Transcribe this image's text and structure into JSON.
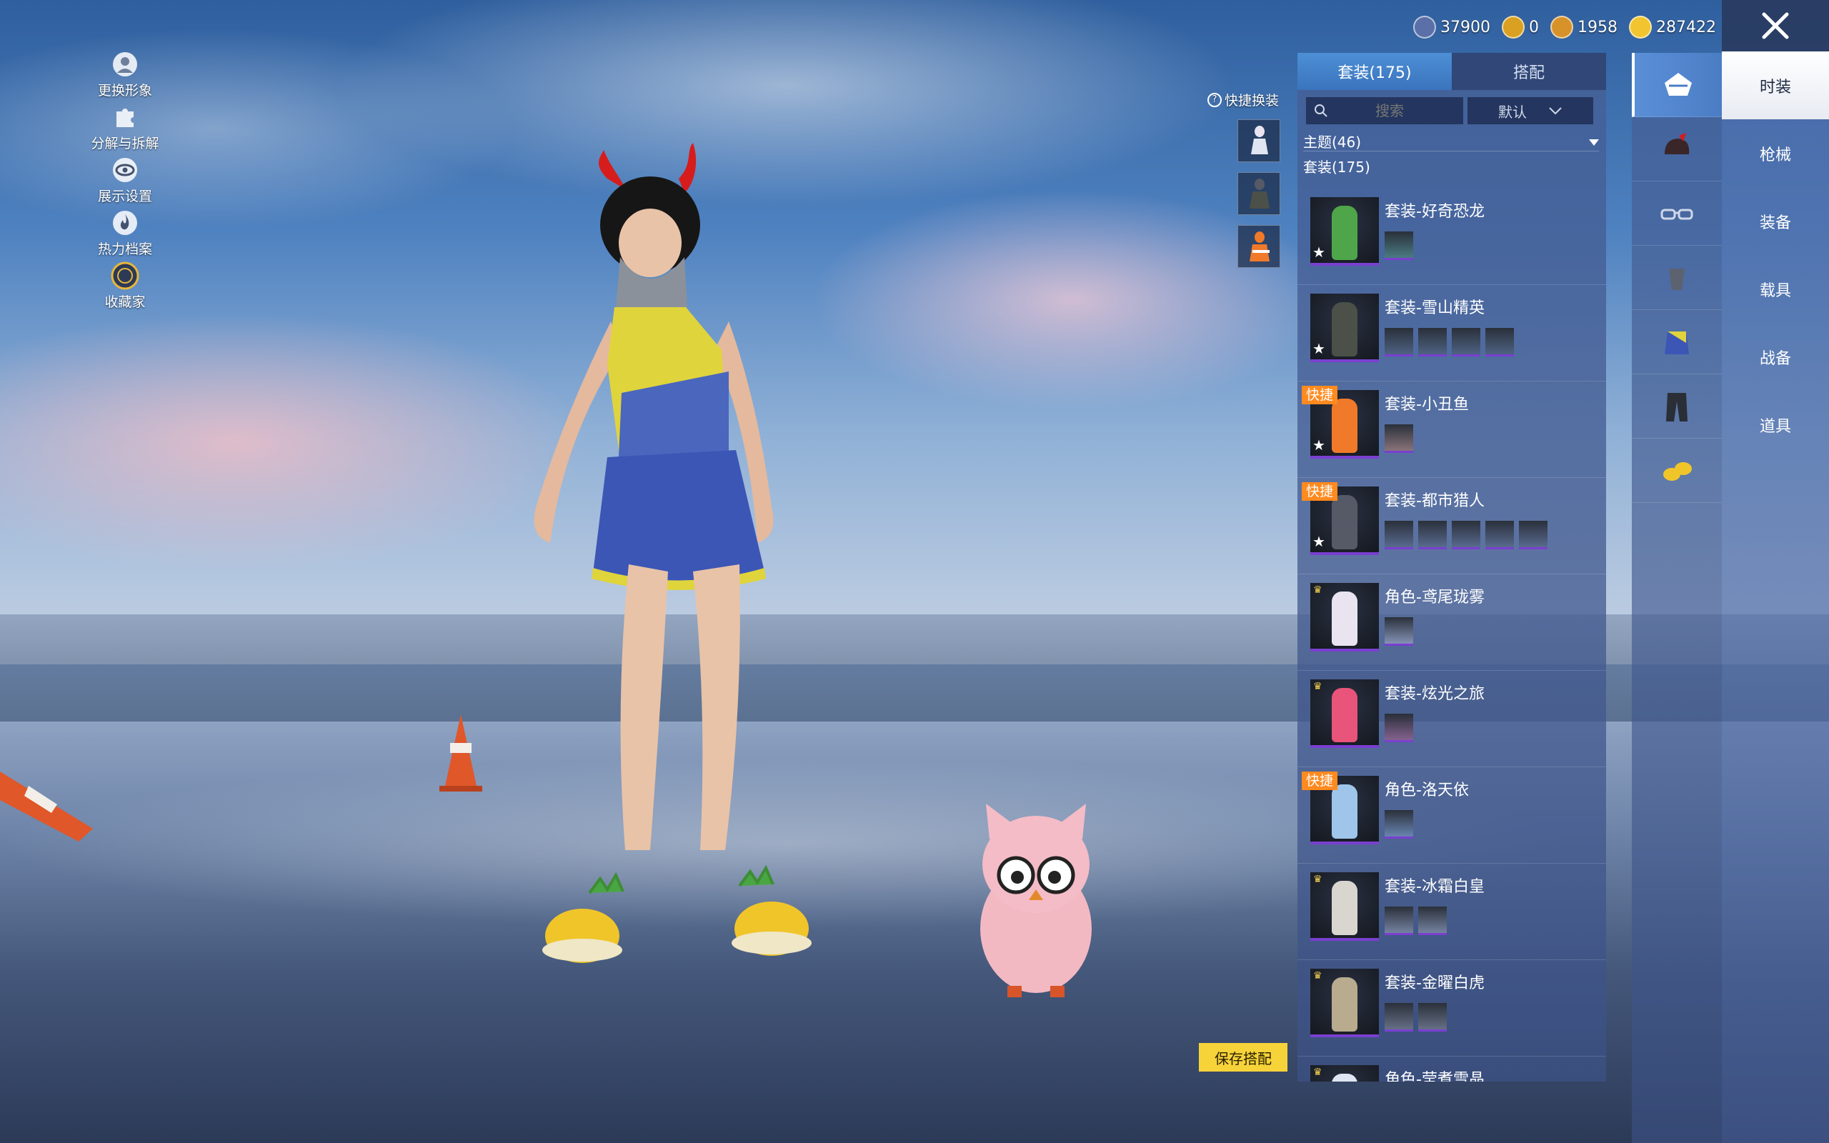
{
  "currencies": [
    {
      "value": "37900",
      "color": "#5b6fa8",
      "icon": "silver-coin-icon"
    },
    {
      "value": "0",
      "color": "#d9a021",
      "icon": "gold-a-coin-icon"
    },
    {
      "value": "1958",
      "color": "#d7922a",
      "icon": "bronze-coin-icon"
    },
    {
      "value": "287422",
      "color": "#f2c430",
      "icon": "lightning-coin-icon"
    }
  ],
  "left_menu": [
    {
      "label": "更换形象",
      "icon": "avatar-icon"
    },
    {
      "label": "分解与拆解",
      "icon": "puzzle-icon"
    },
    {
      "label": "展示设置",
      "icon": "eye-icon"
    },
    {
      "label": "热力档案",
      "icon": "flame-icon"
    },
    {
      "label": "收藏家",
      "icon": "collector-badge-icon"
    }
  ],
  "quick_swap": {
    "title": "快捷换装"
  },
  "panel": {
    "tabs": [
      {
        "label": "套装(175)",
        "active": true
      },
      {
        "label": "搭配",
        "active": false
      }
    ],
    "search_placeholder": "搜索",
    "sort_label": "默认",
    "theme_label": "主题(46)",
    "section_title": "套装(175)",
    "quick_tag": "快捷",
    "items": [
      {
        "name": "套装-好奇恐龙",
        "sub_count": 1,
        "quick": false,
        "star": true,
        "crown": false,
        "color": "#4fa54a"
      },
      {
        "name": "套装-雪山精英",
        "sub_count": 4,
        "quick": false,
        "star": true,
        "crown": false,
        "color": "#4b5048"
      },
      {
        "name": "套装-小丑鱼",
        "sub_count": 1,
        "quick": true,
        "star": true,
        "crown": false,
        "color": "#f07a2a"
      },
      {
        "name": "套装-都市猎人",
        "sub_count": 5,
        "quick": true,
        "star": true,
        "crown": false,
        "color": "#555a66"
      },
      {
        "name": "角色-鸢尾珑雾",
        "sub_count": 1,
        "quick": false,
        "star": false,
        "crown": true,
        "color": "#e9e4f0"
      },
      {
        "name": "套装-炫光之旅",
        "sub_count": 1,
        "quick": false,
        "star": false,
        "crown": true,
        "color": "#e8547a"
      },
      {
        "name": "角色-洛天依",
        "sub_count": 1,
        "quick": true,
        "star": false,
        "crown": false,
        "color": "#9fc6ea"
      },
      {
        "name": "套装-冰霜白皇",
        "sub_count": 2,
        "quick": false,
        "star": false,
        "crown": true,
        "color": "#d9d6d0"
      },
      {
        "name": "套装-金曜白虎",
        "sub_count": 2,
        "quick": false,
        "star": false,
        "crown": true,
        "color": "#b8ab8e"
      },
      {
        "name": "角色-莹煮雪晶",
        "sub_count": 0,
        "quick": false,
        "star": false,
        "crown": true,
        "color": "#dfe6f2"
      }
    ]
  },
  "category_icons": [
    "outfit-icon",
    "helmet-icon",
    "glasses-icon",
    "mask-icon",
    "top-icon",
    "pants-icon",
    "shoes-icon"
  ],
  "side_tabs": [
    {
      "label": "时装",
      "active": true
    },
    {
      "label": "枪械",
      "active": false
    },
    {
      "label": "装备",
      "active": false
    },
    {
      "label": "载具",
      "active": false
    },
    {
      "label": "战备",
      "active": false
    },
    {
      "label": "道具",
      "active": false
    }
  ],
  "save_button": "保存搭配"
}
